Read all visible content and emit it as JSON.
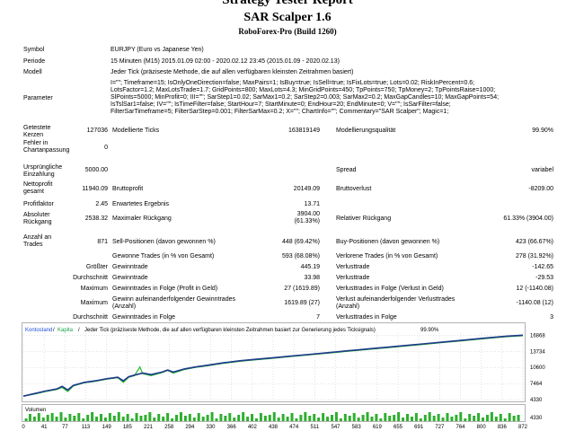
{
  "header": {
    "title": "Strategy Tester Report",
    "expert": "SAR Scalper 1.6",
    "broker": "RoboForex-Pro (Build 1260)"
  },
  "settings": {
    "symbol_label": "Symbol",
    "symbol_value": "EURJPY (Euro vs Japanese Yen)",
    "period_label": "Periode",
    "period_value": "15 Minuten (M15) 2015.01.09 02:00 - 2020.02.12 23:45 (2015.01.09 - 2020.02.13)",
    "model_label": "Modell",
    "model_value": "Jeder Tick (präziseste Methode, die auf allen verfügbaren kleinsten Zeitrahmen basiert)",
    "params_label": "Parameter",
    "params_lines": [
      "I=\"\"; Timeframe=15; IsOnlyOneDirection=false; MaxPairs=1; IsBuy=true; IsSell=true; IsFixLots=true; Lots=0.02; RiskInPercent=0.6;",
      "LotsFactor=1.2; MaxLotsTrade=1.7; GridPoints=800; MaxLots=4.3; MinGridPoints=450; TpPoints=750; TpMoney=2; TpPointsRaise=1000;",
      "SlPoints=5000; MinProfit=0; III=\"\"; SarStep1=0.02; SarMax1=0.2; SarStep2=0.003; SarMax2=0.2; MaxGapCandles=10; MaxGapPoints=54;",
      "IsTslSar1=false; IV=\"\"; IsTimeFilter=false; StartHour=7; StartMinute=0; EndHour=20; EndMinute=0; V=\"\"; IsSarFilter=false;",
      "FilterSarTimeframe=5; FilterSarStep=0.001; FilterSarMax=0.2; X=\"\"; ChartInfo=\"\"; Commentary=\"SAR Scalper\"; Magic=1;"
    ]
  },
  "stats": {
    "bars_label": "Getestete Kerzen",
    "bars_value": "127036",
    "ticks_label": "Modellierte Ticks",
    "ticks_value": "163819149",
    "quality_label": "Modellierungsqualität",
    "quality_value": "99.90%",
    "errors_label": "Fehler in Chartanpassung",
    "errors_value": "0",
    "deposit_label": "Ursprüngliche Einzahlung",
    "deposit_value": "5000.00",
    "spread_label": "Spread",
    "spread_value": "variabel",
    "net_label": "Nettoprofit gesamt",
    "net_value": "11940.09",
    "gross_profit_label": "Bruttoprofit",
    "gross_profit_value": "20149.09",
    "gross_loss_label": "Bruttoverlust",
    "gross_loss_value": "-8209.00",
    "pf_label": "Profitfaktor",
    "pf_value": "2.45",
    "expected_label": "Erwartetes Ergebnis",
    "expected_value": "13.71",
    "abs_dd_label": "Absoluter Rückgang",
    "abs_dd_value": "2538.32",
    "max_dd_label": "Maximaler Rückgang",
    "max_dd_value1": "3904.00",
    "max_dd_value2": "(61.33%)",
    "rel_dd_label": "Relativer Rückgang",
    "rel_dd_value": "61.33% (3904.00)",
    "trades_label": "Anzahl an Trades",
    "trades_value": "871",
    "short_label": "Sell-Positionen (davon gewonnen %)",
    "short_value": "448 (69.42%)",
    "long_label": "Buy-Positionen (davon gewonnen %)",
    "long_value": "423 (66.67%)",
    "won_label": "Gewonne Trades (in % von Gesamt)",
    "won_value": "593 (68.08%)",
    "lost_label": "Verlorene Trades (in % von Gesamt)",
    "lost_value": "278 (31.92%)",
    "largest_label": "Größter",
    "largest_win_label": "Gewinntrade",
    "largest_win_value": "445.19",
    "largest_loss_label": "Verlusttrade",
    "largest_loss_value": "-142.65",
    "average_label": "Durchschnitt",
    "avg_win_label": "Gewinntrade",
    "avg_win_value": "33.98",
    "avg_loss_label": "Verlusttrade",
    "avg_loss_value": "-29.53",
    "maximum_label": "Maximum",
    "max_consec_wins_label": "Gewinntrades in Folge (Profit in Geld)",
    "max_consec_wins_value": "27 (1619.89)",
    "max_consec_losses_label": "Verlusttrades in Folge (Verlust in Geld)",
    "max_consec_losses_value": "12 (-1140.08)",
    "maximum2_label": "Maximum",
    "max_consec_profit_label": "Gewinn aufeinanderfolgender Gewinntrades (Anzahl)",
    "max_consec_profit_value": "1619.89 (27)",
    "max_consec_loss_label": "Verlust aufeinanderfolgender Verlusttrades (Anzahl)",
    "max_consec_loss_value": "-1140.08 (12)",
    "average2_label": "Durchschnitt",
    "avg_consec_wins_label": "Gewinntrades in Folge",
    "avg_consec_wins_value": "7",
    "avg_consec_losses_label": "Verlusttrades in Folge",
    "avg_consec_losses_value": "3"
  },
  "colors": {
    "balance": "#1e3a8a",
    "equity": "#1fb82b",
    "volume": "#2fae2f",
    "grid": "#b8b8b8",
    "legend_balance": "#1d4ed8",
    "legend_equity": "#16a34a"
  },
  "chart_data": {
    "type": "line",
    "legend": {
      "balance": "Kontostand",
      "sep1": "/",
      "equity": "Kapita",
      "sep2": "/",
      "model": "Jeder Tick (präziseste Methode, die auf allen verfügbaren kleinsten Zeitrahmen basiert zur Generierung jedes Ticksignals)",
      "quality": "99.90%"
    },
    "y_ticks": [
      "16868",
      "13734",
      "10600",
      "7464",
      "4330"
    ],
    "y_tick_values": [
      16868,
      13734,
      10600,
      7464,
      4330
    ],
    "ylim": [
      4330,
      17300
    ],
    "x_ticks": [
      "0",
      "41",
      "77",
      "113",
      "149",
      "185",
      "221",
      "258",
      "294",
      "330",
      "366",
      "402",
      "438",
      "474",
      "511",
      "547",
      "583",
      "619",
      "655",
      "691",
      "727",
      "764",
      "800",
      "836",
      "872"
    ],
    "xlim": [
      0,
      900
    ],
    "volume_label": "Volumen",
    "balance": {
      "x": [
        0,
        20,
        40,
        60,
        70,
        80,
        90,
        100,
        110,
        130,
        150,
        170,
        180,
        190,
        200,
        215,
        230,
        250,
        260,
        270,
        290,
        310,
        330,
        360,
        390,
        420,
        450,
        480,
        510,
        540,
        570,
        600,
        630,
        660,
        690,
        720,
        750,
        780,
        810,
        840,
        870,
        900
      ],
      "y": [
        5000,
        5500,
        6000,
        6400,
        6900,
        6200,
        7100,
        7400,
        7700,
        8000,
        8400,
        8700,
        8000,
        8800,
        9100,
        9500,
        9200,
        9700,
        10100,
        9700,
        10300,
        10700,
        11000,
        11500,
        11900,
        12200,
        12500,
        12800,
        13100,
        13400,
        13700,
        14000,
        14300,
        14600,
        14900,
        15200,
        15500,
        15800,
        16100,
        16400,
        16700,
        16900
      ]
    },
    "equity": {
      "x": [
        0,
        20,
        40,
        60,
        70,
        80,
        90,
        100,
        110,
        130,
        150,
        170,
        180,
        190,
        200,
        210,
        215,
        230,
        250,
        260,
        270,
        290,
        310,
        330,
        360,
        390,
        420,
        450,
        480,
        510,
        540,
        570,
        600,
        630,
        660,
        690,
        720,
        750,
        780,
        810,
        840,
        870,
        900
      ],
      "y": [
        5000,
        5400,
        5900,
        6300,
        6700,
        5900,
        7000,
        7300,
        7600,
        7900,
        8300,
        8600,
        7700,
        8700,
        9000,
        10700,
        9400,
        9000,
        9600,
        10000,
        9500,
        10200,
        10600,
        10900,
        11400,
        11800,
        12100,
        12400,
        12700,
        13000,
        13300,
        13600,
        13900,
        14200,
        14500,
        14800,
        15100,
        15400,
        15700,
        16000,
        16300,
        16600,
        16800
      ]
    },
    "volume": {
      "x": [
        5,
        12,
        20,
        28,
        36,
        44,
        52,
        60,
        68,
        76,
        84,
        92,
        100,
        108,
        116,
        124,
        132,
        140,
        148,
        156,
        164,
        172,
        180,
        188,
        196,
        204,
        212,
        220,
        228,
        236,
        244,
        252,
        260,
        268,
        276,
        284,
        292,
        300,
        308,
        316,
        324,
        332,
        340,
        348,
        356,
        364,
        372,
        380,
        388,
        396,
        404,
        412,
        420,
        428,
        436,
        444,
        452,
        460,
        468,
        476,
        484,
        492,
        500,
        508,
        516,
        524,
        532,
        540,
        548,
        556,
        564,
        572,
        580,
        588,
        596,
        604,
        612,
        620,
        628,
        636,
        644,
        652,
        660,
        668,
        676,
        684,
        692,
        700,
        708,
        716,
        724,
        732,
        740,
        748,
        756,
        764,
        772,
        780,
        788,
        796,
        804,
        812,
        820,
        828,
        836,
        844,
        852,
        860,
        868,
        876,
        884,
        892
      ],
      "y": [
        0.3,
        0.8,
        0.5,
        0.9,
        0.4,
        0.7,
        0.9,
        0.5,
        1.0,
        0.4,
        0.8,
        0.6,
        0.9,
        0.3,
        0.7,
        1.0,
        0.5,
        0.8,
        0.4,
        0.9,
        0.6,
        1.0,
        0.5,
        0.8,
        0.3,
        0.9,
        0.6,
        0.7,
        1.0,
        0.4,
        0.8,
        0.5,
        0.9,
        0.3,
        0.7,
        1.0,
        0.6,
        0.8,
        0.4,
        0.9,
        0.5,
        0.7,
        1.0,
        0.3,
        0.8,
        0.6,
        0.9,
        0.4,
        0.7,
        1.0,
        0.5,
        0.8,
        0.3,
        0.9,
        0.6,
        0.7,
        1.0,
        0.4,
        0.8,
        0.5,
        0.9,
        0.3,
        0.7,
        1.0,
        0.6,
        0.8,
        0.4,
        0.9,
        0.5,
        0.7,
        1.0,
        0.3,
        0.8,
        0.6,
        0.9,
        0.4,
        0.7,
        1.0,
        0.5,
        0.8,
        0.3,
        0.9,
        0.6,
        0.7,
        1.0,
        0.4,
        0.8,
        0.5,
        0.9,
        0.3,
        0.7,
        1.0,
        0.6,
        0.8,
        0.4,
        0.9,
        0.5,
        0.7,
        1.0,
        0.3,
        0.8,
        0.6,
        0.9,
        0.4,
        0.7,
        1.0,
        0.5,
        0.8,
        0.3,
        0.9,
        0.6,
        0.7
      ]
    }
  }
}
